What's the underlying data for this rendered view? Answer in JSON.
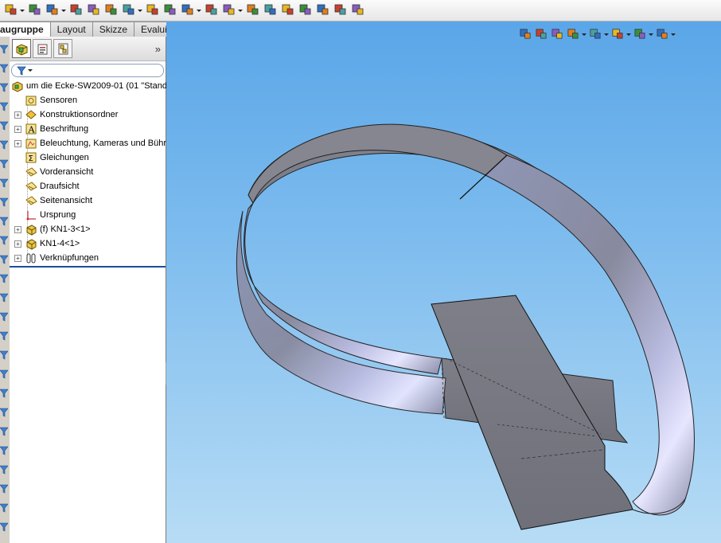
{
  "tabs": [
    {
      "label": "augruppe",
      "active": true
    },
    {
      "label": "Layout",
      "active": false
    },
    {
      "label": "Skizze",
      "active": false
    },
    {
      "label": "Evaluieren",
      "active": false
    }
  ],
  "toolbar": {
    "icons": [
      "open-icon",
      "paperclip-icon",
      "mate-icon",
      "component-icon",
      "insert-icon",
      "linear-pattern-icon",
      "explode-icon",
      "rotate-icon",
      "hide-show-icon",
      "configure-icon",
      "sketch-icon",
      "tools-icon",
      "smart-fasteners-icon",
      "move-icon",
      "assembly-icon",
      "reference-icon",
      "instant3d-icon",
      "table-icon",
      "color-icon"
    ]
  },
  "headsup": {
    "icons": [
      "zoom-fit-icon",
      "zoom-area-icon",
      "section-view-icon",
      "view-orientation-icon",
      "display-style-icon",
      "edit-appearance-icon",
      "scene-icon",
      "view-settings-icon"
    ]
  },
  "feature_manager": {
    "tabs": [
      "featuremanager-tab-icon",
      "propertymanager-tab-icon",
      "configurationmanager-tab-icon"
    ],
    "expand_label": "»",
    "tree": [
      {
        "label": "um die Ecke-SW2009-01  (01 \"Stand",
        "icon": "assembly-icon",
        "expandable": false,
        "indent": 0
      },
      {
        "label": "Sensoren",
        "icon": "sensor-icon",
        "expandable": false,
        "indent": 1
      },
      {
        "label": "Konstruktionsordner",
        "icon": "design-binder-icon",
        "expandable": true,
        "indent": 1
      },
      {
        "label": "Beschriftung",
        "icon": "annotation-icon",
        "expandable": true,
        "indent": 1
      },
      {
        "label": "Beleuchtung, Kameras und Bühr",
        "icon": "lights-icon",
        "expandable": true,
        "indent": 1
      },
      {
        "label": "Gleichungen",
        "icon": "equations-icon",
        "expandable": false,
        "indent": 1
      },
      {
        "label": "Vorderansicht",
        "icon": "plane-icon",
        "expandable": false,
        "indent": 1
      },
      {
        "label": "Draufsicht",
        "icon": "plane-icon",
        "expandable": false,
        "indent": 1
      },
      {
        "label": "Seitenansicht",
        "icon": "plane-icon",
        "expandable": false,
        "indent": 1
      },
      {
        "label": "Ursprung",
        "icon": "origin-icon",
        "expandable": false,
        "indent": 1
      },
      {
        "label": "(f) KN1-3<1>",
        "icon": "part-icon",
        "expandable": true,
        "indent": 1
      },
      {
        "label": "KN1-4<1>",
        "icon": "part-icon",
        "expandable": true,
        "indent": 1
      },
      {
        "label": "Verknüpfungen",
        "icon": "mates-icon",
        "expandable": true,
        "indent": 1
      }
    ]
  },
  "colors": {
    "viewport_top": "#5aa6e8",
    "viewport_bottom": "#b7dcf5",
    "model_face": "#8b8fa6",
    "rollback_bar": "#1b4f9c"
  }
}
